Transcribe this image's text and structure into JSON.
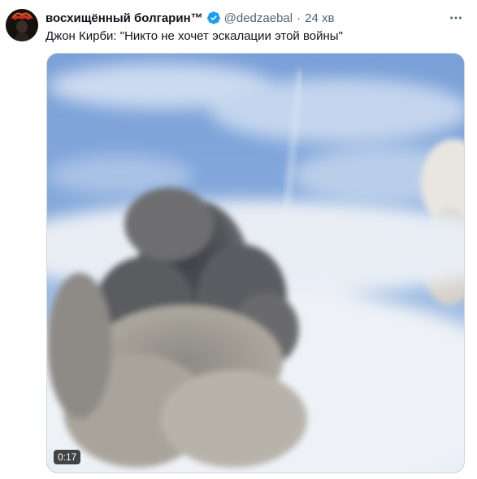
{
  "tweet": {
    "author": {
      "display_name": "восхищённый болгарин™",
      "handle": "@dedzaebal",
      "verified": true
    },
    "separator": "·",
    "timestamp": "24 хв",
    "text": "Джон Кирби: \"Никто не хочет эскалации этой войны\"",
    "media": {
      "kind": "video",
      "duration": "0:17"
    }
  },
  "colors": {
    "verified_badge": "#1d9bf0",
    "secondary_text": "#536471",
    "primary_text": "#0f1419"
  },
  "icons": {
    "verified": "verified-badge-icon",
    "more": "more-dots-icon"
  }
}
